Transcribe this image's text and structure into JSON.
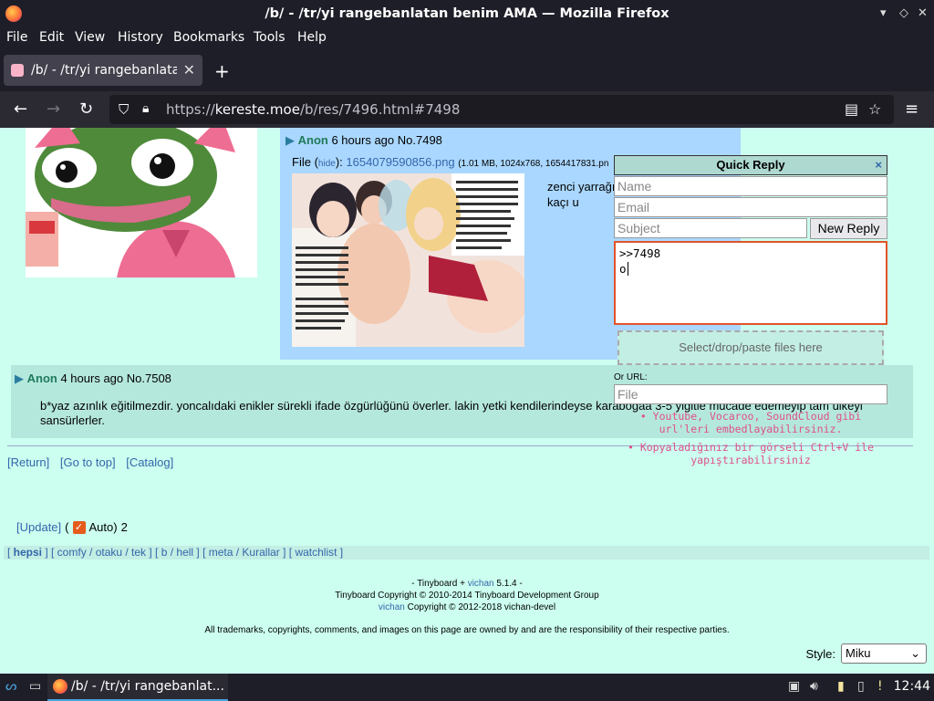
{
  "window": {
    "title": "/b/ - /tr/yi rangebanlatan benim AMA — Mozilla Firefox"
  },
  "menu": [
    "File",
    "Edit",
    "View",
    "History",
    "Bookmarks",
    "Tools",
    "Help"
  ],
  "tab": {
    "label": "/b/ - /tr/yi rangebanlatan"
  },
  "url": {
    "prefix": "https://",
    "domain": "kereste.moe",
    "path": "/b/res/7496.html#7498"
  },
  "posts": {
    "p7498": {
      "name": "Anon",
      "time": "6 hours ago",
      "no": "No.7498",
      "file_label": "File",
      "hide": "hide",
      "filename": "1654079590856.png",
      "fileinfo": "(1.01 MB, 1024x768, 1654417831.pn",
      "body": "zenci yarrağı tamamen iro yüzde kaçı u"
    },
    "p7508": {
      "name": "Anon",
      "time": "4 hours ago",
      "no": "No.7508",
      "body": "b*yaz azınlık eğitilmezdir. yoncalıdaki enikler sürekli ifade özgürlüğünü överler. lakin yetki kendilerindeyse karabogaa 3-5 yiğitle mucade edemeyip tam ülkeyi sansürlerler."
    }
  },
  "nav_links": {
    "return": "[Return]",
    "top": "[Go to top]",
    "catalog": "[Catalog]"
  },
  "update": {
    "update_link": "[Update]",
    "open": "(",
    "auto": "Auto)",
    "count": "2"
  },
  "boardlist": {
    "text_pre": "[ ",
    "hepsi": "hepsi",
    "rest": " ] [ comfy / otaku / tek ] [ b / hell ] [ meta / Kurallar ] [ watchlist ]"
  },
  "footer": {
    "line1_pre": "- Tinyboard + ",
    "line1_link": "vichan",
    "line1_post": " 5.1.4 -",
    "line2": "Tinyboard Copyright © 2010-2014 Tinyboard Development Group",
    "line3_link": "vichan",
    "line3_post": " Copyright © 2012-2018 vichan-devel",
    "disclaimer": "All trademarks, copyrights, comments, and images on this page are owned by and are the responsibility of their respective parties."
  },
  "style": {
    "label": "Style:",
    "value": "Miku"
  },
  "quick_reply": {
    "title": "Quick Reply",
    "close": "×",
    "name_placeholder": "Name",
    "email_placeholder": "Email",
    "subject_placeholder": "Subject",
    "submit": "New Reply",
    "body_line1": ">>7498",
    "body_line2": "o",
    "dropzone": "Select/drop/paste files here",
    "or_url": "Or URL:",
    "file_placeholder": "File",
    "tip1": "• Youtube, Vocaroo, SoundCloud gibi url'leri embedlayabilirsiniz.",
    "tip2": "• Kopyaladığınız bir görseli Ctrl+V ile yapıştırabilirsiniz"
  },
  "taskbar": {
    "task_label": "/b/ - /tr/yi rangebanlat...",
    "clock": "12:44"
  },
  "colors": {
    "page_bg": "#ccfff0",
    "post_bg": "#aad7ff",
    "reply_bg": "#b5e8dd",
    "link": "#3366aa",
    "name": "#1e7a5a",
    "tip": "#e0508a",
    "focus_border": "#e2542a"
  }
}
